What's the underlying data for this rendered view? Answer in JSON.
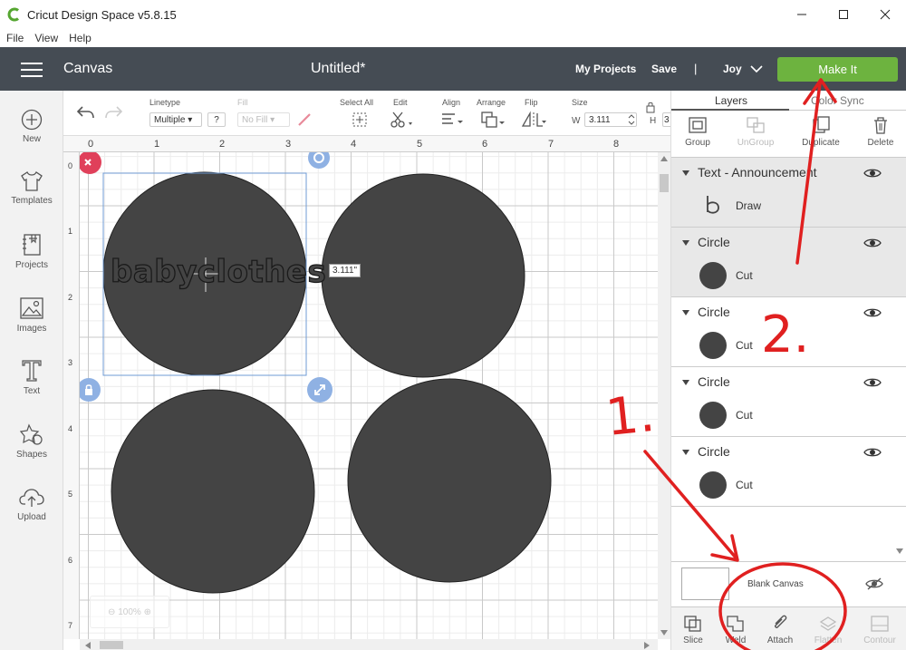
{
  "window": {
    "title": "Cricut Design Space  v5.8.15"
  },
  "menu": [
    "File",
    "View",
    "Help"
  ],
  "header": {
    "section": "Canvas",
    "project_title": "Untitled*",
    "my_projects": "My Projects",
    "save": "Save",
    "separator": "|",
    "user": "Joy",
    "make_it": "Make It"
  },
  "sidebar": [
    {
      "label": "New",
      "icon": "plus-circle-icon"
    },
    {
      "label": "Templates",
      "icon": "tshirt-icon"
    },
    {
      "label": "Projects",
      "icon": "notebook-icon"
    },
    {
      "label": "Images",
      "icon": "image-icon"
    },
    {
      "label": "Text",
      "icon": "text-icon"
    },
    {
      "label": "Shapes",
      "icon": "shapes-icon"
    },
    {
      "label": "Upload",
      "icon": "cloud-upload-icon"
    }
  ],
  "toolbar": {
    "linetype_label": "Linetype",
    "linetype_value": "Multiple",
    "help": "?",
    "fill_label": "Fill",
    "fill_value": "No Fill",
    "select_all": "Select All",
    "edit": "Edit",
    "align": "Align",
    "arrange": "Arrange",
    "flip": "Flip",
    "size": "Size",
    "w_label": "W",
    "w_value": "3.111",
    "h_label": "H",
    "h_value": "3"
  },
  "ruler": {
    "top": [
      "0",
      "1",
      "2",
      "3",
      "4",
      "5",
      "6",
      "7",
      "8"
    ],
    "left": [
      "0",
      "1",
      "2",
      "3",
      "4",
      "5",
      "6",
      "7"
    ]
  },
  "canvas": {
    "text_object": "babyclothes",
    "size_tooltip": "3.111\"",
    "zoom_ghost": "100%"
  },
  "panel": {
    "tabs": [
      "Layers",
      "Color Sync"
    ],
    "tools": [
      "Group",
      "UnGroup",
      "Duplicate",
      "Delete"
    ],
    "layers": [
      {
        "name": "Text - Announcement",
        "operation": "Draw",
        "type": "text"
      },
      {
        "name": "Circle",
        "operation": "Cut",
        "type": "shape"
      },
      {
        "name": "Circle",
        "operation": "Cut",
        "type": "shape"
      },
      {
        "name": "Circle",
        "operation": "Cut",
        "type": "shape"
      },
      {
        "name": "Circle",
        "operation": "Cut",
        "type": "shape"
      }
    ],
    "blank_canvas": "Blank Canvas",
    "bottom_tools": [
      "Slice",
      "Weld",
      "Attach",
      "Flatten",
      "Contour"
    ]
  },
  "annotations": {
    "one": "1.",
    "two": "2."
  },
  "colors": {
    "header": "#454c54",
    "make_it": "#6db33f",
    "shape_fill": "#444444",
    "annotation": "#e02020"
  }
}
